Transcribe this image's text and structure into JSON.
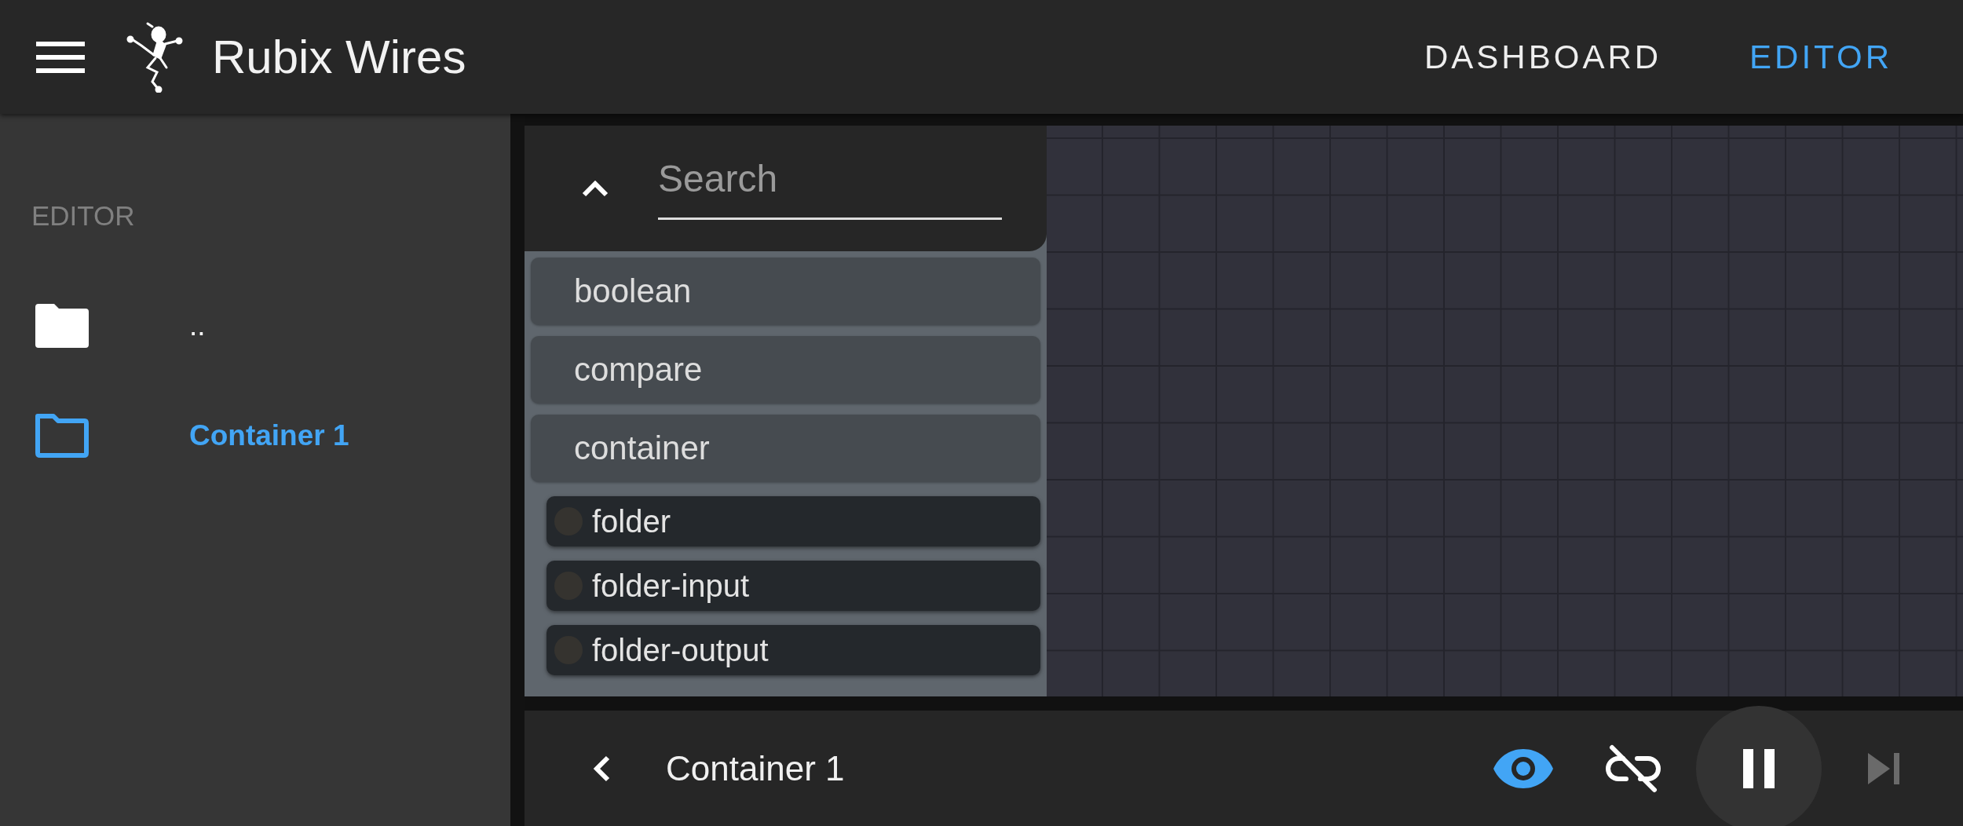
{
  "app_bar": {
    "title": "Rubix Wires",
    "nav": [
      {
        "label": "DASHBOARD",
        "selected": false
      },
      {
        "label": "EDITOR",
        "selected": true
      }
    ]
  },
  "sidebar": {
    "section_label": "EDITOR",
    "items": [
      {
        "kind": "parent",
        "label": "..",
        "selected": false
      },
      {
        "kind": "folder",
        "label": "Container 1",
        "selected": true
      }
    ]
  },
  "palette": {
    "expanded": true,
    "search": {
      "placeholder": "Search"
    },
    "categories": [
      {
        "label": "boolean",
        "expanded": false
      },
      {
        "label": "compare",
        "expanded": false
      },
      {
        "label": "container",
        "expanded": true,
        "children": [
          {
            "label": "folder"
          },
          {
            "label": "folder-input"
          },
          {
            "label": "folder-output"
          }
        ]
      }
    ]
  },
  "bottom_bar": {
    "title": "Container 1",
    "controls": [
      {
        "kind": "visibility",
        "on": true
      },
      {
        "kind": "links",
        "on": false
      },
      {
        "kind": "pause",
        "on": true
      },
      {
        "kind": "step",
        "disabled": true
      }
    ]
  }
}
